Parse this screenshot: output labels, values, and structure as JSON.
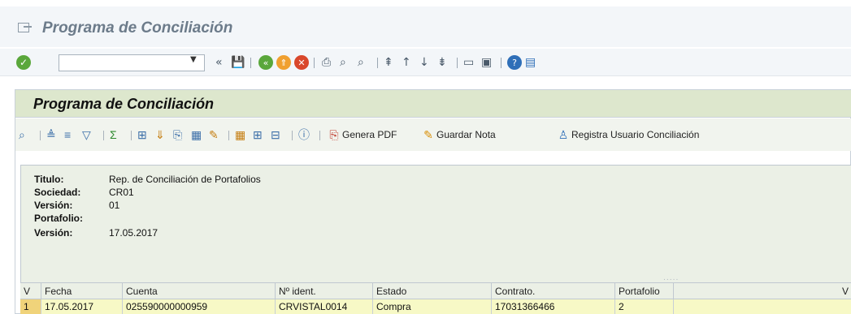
{
  "window": {
    "title": "Programa de Conciliación"
  },
  "std_toolbar": {
    "command_field_value": "",
    "collapse_glyph": "«"
  },
  "panel": {
    "title": "Programa de Conciliación",
    "toolbar": {
      "genera_pdf": "Genera PDF",
      "guardar_nota": "Guardar Nota",
      "registra_usuario": "Registra Usuario Conciliación"
    }
  },
  "header_info": {
    "titulo_label": "Titulo:",
    "titulo_value": "Rep. de Conciliación de Portafolios",
    "sociedad_label": "Sociedad:",
    "sociedad_value": "CR01",
    "version1_label": "Versión:",
    "version1_value": "01",
    "portafolio_label": "Portafolio:",
    "portafolio_value": "",
    "version2_label": "Versión:",
    "version2_value": "17.05.2017",
    "resize_dots": "....."
  },
  "grid": {
    "columns": [
      "V",
      "Fecha",
      "Cuenta",
      "Nº ident.",
      "Estado",
      "Contrato.",
      "Portafolio",
      "V"
    ],
    "rows": [
      [
        "1",
        "17.05.2017",
        "025590000000959",
        "CRVISTAL0014",
        "Compra",
        "17031366466",
        "2",
        ""
      ]
    ]
  },
  "colors": {
    "panel_title_bg": "#dde7cd",
    "row_highlight": "#f7f9c6",
    "row_number_bg": "#f0d37a"
  }
}
